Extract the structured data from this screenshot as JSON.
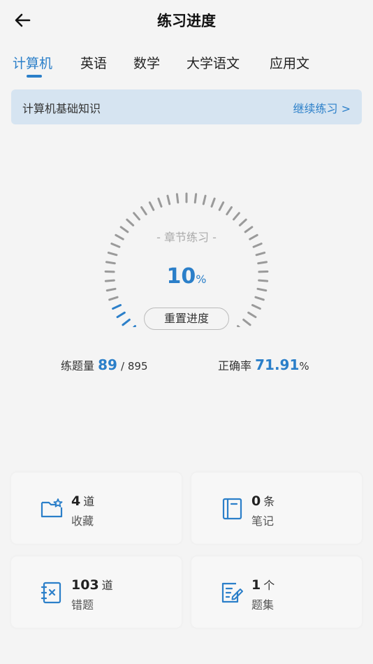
{
  "header": {
    "title": "练习进度"
  },
  "tabs": [
    {
      "label": "计算机",
      "active": true
    },
    {
      "label": "英语",
      "active": false
    },
    {
      "label": "数学",
      "active": false
    },
    {
      "label": "大学语文",
      "active": false
    },
    {
      "label": "应用文",
      "active": false
    }
  ],
  "banner": {
    "title": "计算机基础知识",
    "link": "继续练习 >"
  },
  "gauge": {
    "label": "- 章节练习 -",
    "value": "10",
    "unit": "%",
    "progress": 0.1,
    "reset_label": "重置进度"
  },
  "stats": {
    "questions": {
      "label": "练题量",
      "value": "89",
      "total": "/ 895"
    },
    "accuracy": {
      "label": "正确率",
      "value": "71.91",
      "unit": "%"
    }
  },
  "cards": [
    {
      "count": "4",
      "unit": "道",
      "label": "收藏",
      "icon": "folder-star-icon"
    },
    {
      "count": "0",
      "unit": "条",
      "label": "笔记",
      "icon": "notebook-icon"
    },
    {
      "count": "103",
      "unit": "道",
      "label": "错题",
      "icon": "wrong-book-icon"
    },
    {
      "count": "1",
      "unit": "个",
      "label": "题集",
      "icon": "edit-list-icon"
    }
  ],
  "colors": {
    "accent": "#2b7fc9",
    "banner_bg": "#d6e4f1",
    "tick_gray": "#9a9a9a"
  }
}
